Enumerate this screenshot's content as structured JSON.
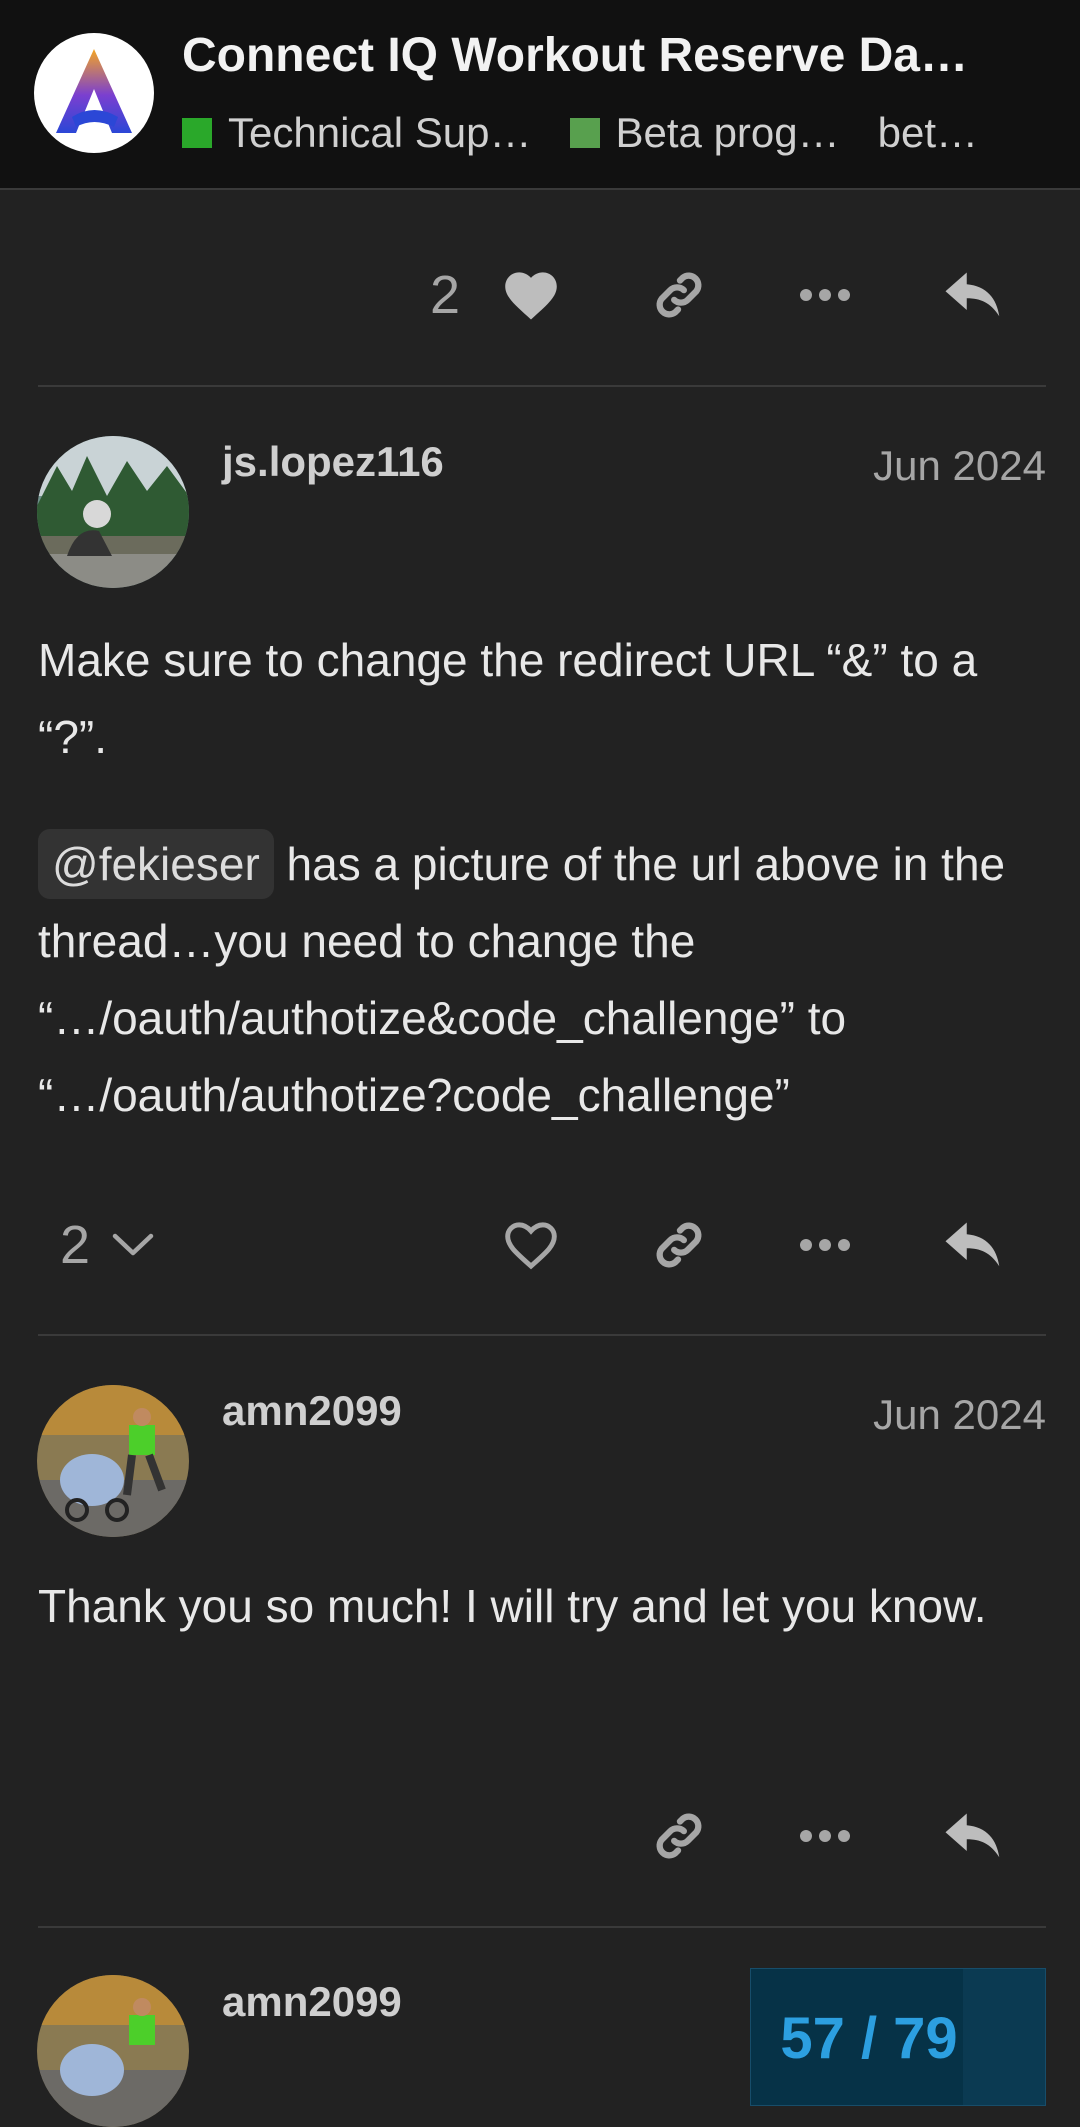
{
  "header": {
    "title": "Connect IQ Workout Reserve Da…",
    "categories": [
      {
        "label": "Technical Sup…",
        "color": "#2aa82a"
      },
      {
        "label": "Beta prog…",
        "color": "#58a04e"
      },
      {
        "label": "bet…"
      }
    ]
  },
  "posts": [
    {
      "like_count": "2"
    },
    {
      "username": "js.lopez116",
      "date": "Jun 2024",
      "paragraph1": "Make sure to change the redirect URL “&” to a “?”.",
      "mention": "@fekieser",
      "paragraph2": " has a picture of the url above in the thread…you need to change the “…/oauth/authotize&code_challenge” to “…/oauth/authotize?code_challenge”",
      "replies_count": "2"
    },
    {
      "username": "amn2099",
      "date": "Jun 2024",
      "paragraph1": "Thank you so much! I will try and let you know."
    },
    {
      "username": "amn2099"
    }
  ],
  "progress": {
    "text": "57 / 79",
    "current": 57,
    "total": 79,
    "accent": "#2c9fe0"
  }
}
